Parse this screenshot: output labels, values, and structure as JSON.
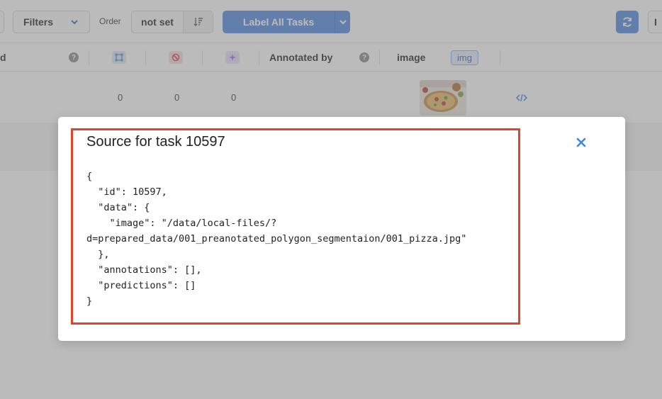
{
  "toolbar": {
    "filters_label": "Filters",
    "order_label": "Order",
    "order_value": "not set",
    "label_all_label": "Label All Tasks",
    "right_stub_label": "I"
  },
  "columns": {
    "first_partial": "d",
    "annotated_by": "Annotated by",
    "image": "image",
    "img_badge": "img"
  },
  "rows": [
    {
      "total_annotations": "0",
      "cancelled": "0",
      "predictions": "0"
    }
  ],
  "modal": {
    "title": "Source for task 10597",
    "code_lines": [
      "{",
      "  \"id\": 10597,",
      "  \"data\": {",
      "    \"image\": \"/data/local-files/?",
      "d=prepared_data/001_preanotated_polygon_segmentaion/001_pizza.jpg\"",
      "  },",
      "  \"annotations\": [],",
      "  \"predictions\": []",
      "}"
    ]
  },
  "colors": {
    "primary": "#4a87dc",
    "highlight_border": "#e0452b",
    "close_icon": "#3f86e0"
  },
  "icons": [
    "chevron-down-icon",
    "sort-icon",
    "refresh-icon",
    "question-icon",
    "annotations-icon",
    "cancelled-icon",
    "predictions-icon",
    "code-icon",
    "close-icon"
  ]
}
